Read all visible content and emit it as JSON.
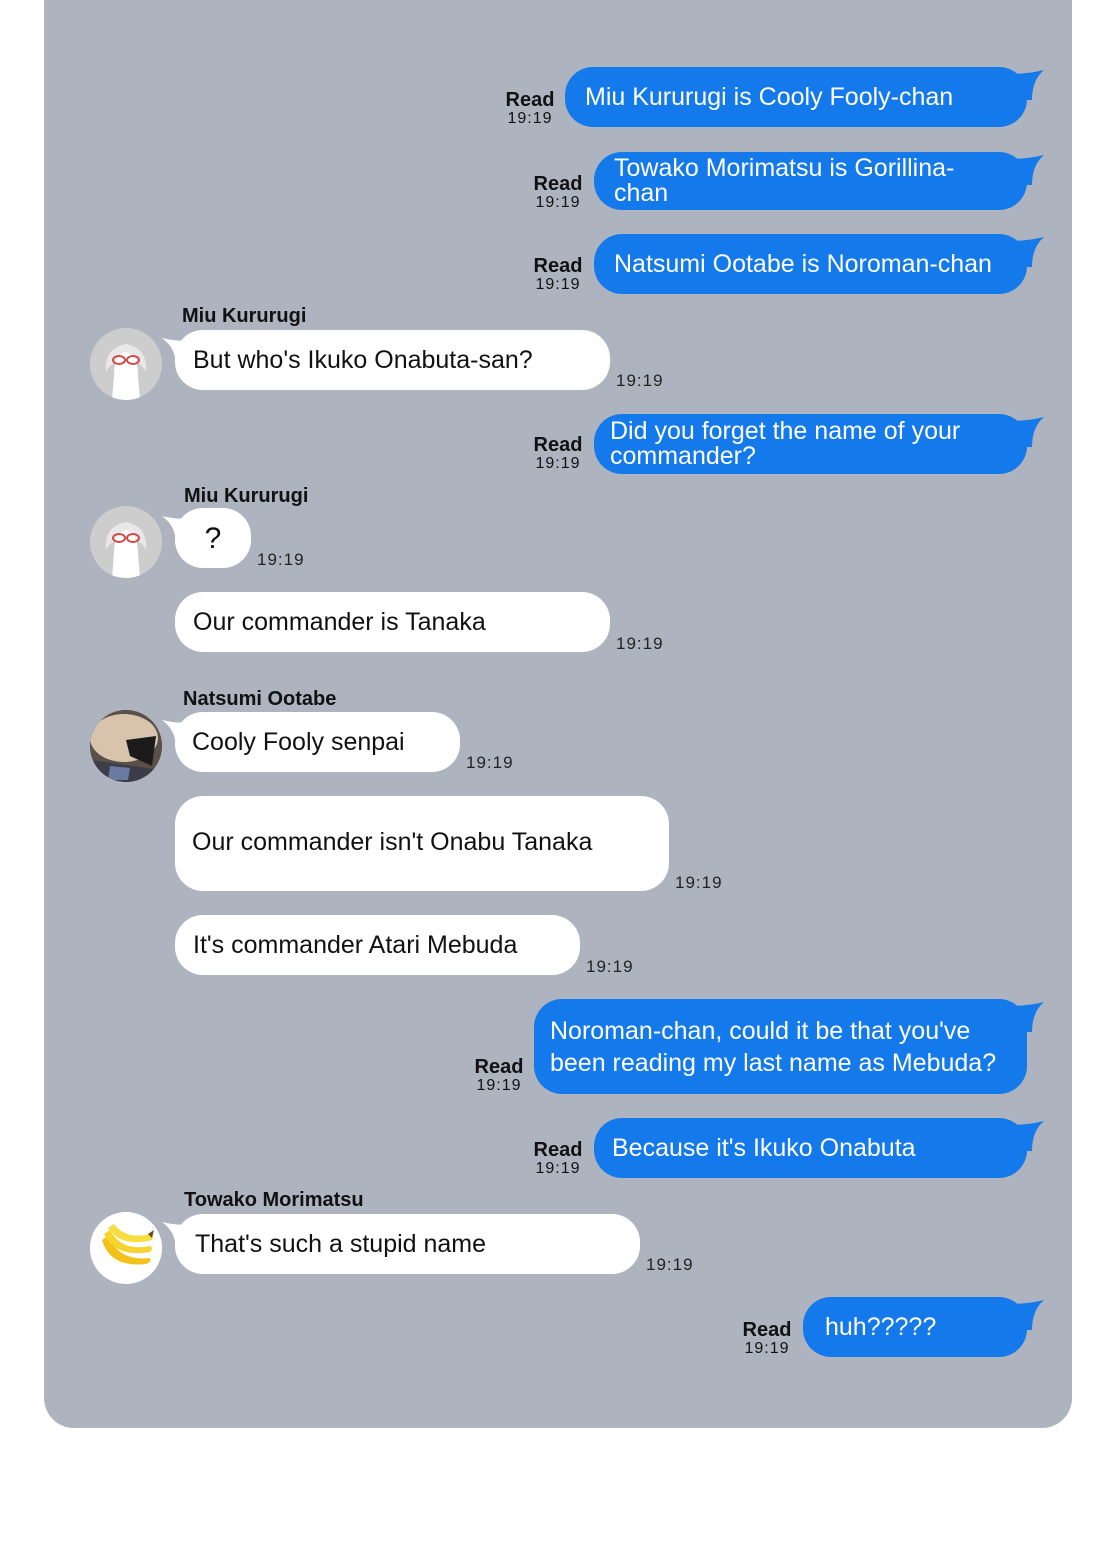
{
  "colors": {
    "panel_bg": "#aeb4bf",
    "outgoing_bubble": "#1479ea",
    "incoming_bubble": "#ffffff"
  },
  "read_label": "Read",
  "messages": [
    {
      "dir": "out",
      "text": "Miu Kururugi is Cooly Fooly-chan",
      "time": "19:19"
    },
    {
      "dir": "out",
      "text": "Towako Morimatsu is Gorillina-chan",
      "time": "19:19"
    },
    {
      "dir": "out",
      "text": "Natsumi Ootabe is Noroman-chan",
      "time": "19:19"
    },
    {
      "dir": "in",
      "sender": "Miu Kururugi",
      "avatar": "glasses-girl",
      "text": "But who's Ikuko Onabuta-san?",
      "time": "19:19"
    },
    {
      "dir": "out",
      "text": "Did you forget the name of your commander?",
      "time": "19:19"
    },
    {
      "dir": "in",
      "sender": "Miu Kururugi",
      "avatar": "glasses-girl",
      "text": "?",
      "time": "19:19"
    },
    {
      "dir": "in",
      "text": "Our commander is Tanaka",
      "time": "19:19"
    },
    {
      "dir": "in",
      "sender": "Natsumi Ootabe",
      "avatar": "photo",
      "text": "Cooly Fooly senpai",
      "time": "19:19"
    },
    {
      "dir": "in",
      "text": "Our commander isn't Onabu Tanaka",
      "time": "19:19"
    },
    {
      "dir": "in",
      "text": "It's commander Atari Mebuda",
      "time": "19:19"
    },
    {
      "dir": "out",
      "text": "Noroman-chan, could it be that you've been reading my last name as Mebuda?",
      "time": "19:19"
    },
    {
      "dir": "out",
      "text": "Because it's Ikuko Onabuta",
      "time": "19:19"
    },
    {
      "dir": "in",
      "sender": "Towako Morimatsu",
      "avatar": "banana",
      "text": "That's such a stupid name",
      "time": "19:19"
    },
    {
      "dir": "out",
      "text": "huh?????",
      "time": "19:19"
    }
  ]
}
